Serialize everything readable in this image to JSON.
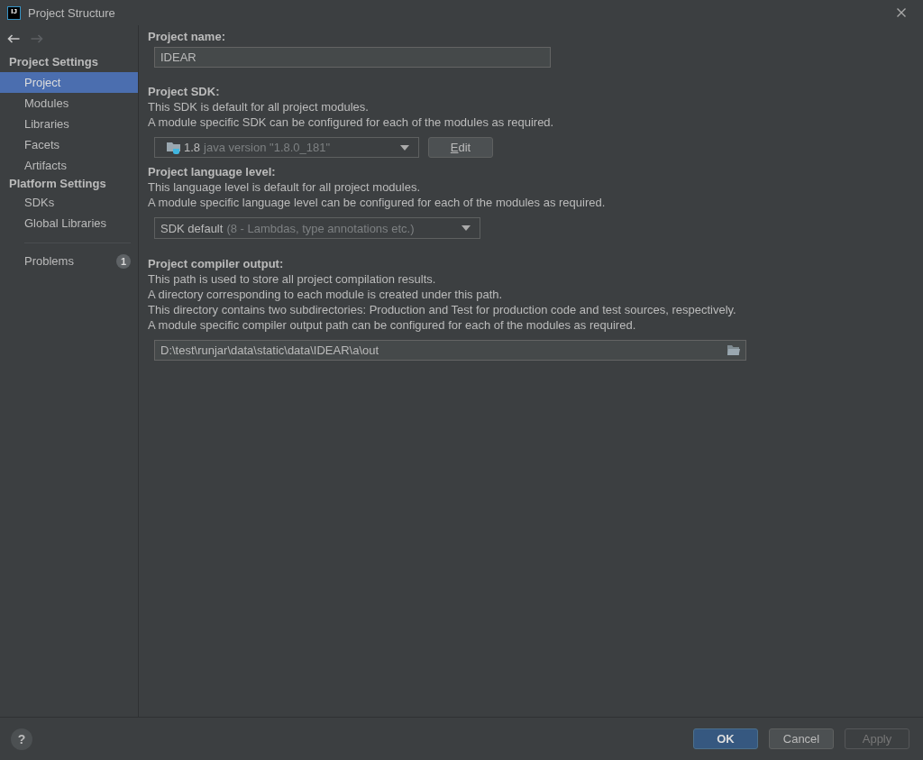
{
  "window": {
    "logo": "IJ",
    "title": "Project Structure"
  },
  "sidebar": {
    "navigation": {
      "back": {
        "disabled": false
      },
      "forward": {
        "disabled": true
      }
    },
    "sections": [
      {
        "heading": "Project Settings",
        "items": [
          {
            "label": "Project",
            "selected": true
          },
          {
            "label": "Modules",
            "selected": false
          },
          {
            "label": "Libraries",
            "selected": false
          },
          {
            "label": "Facets",
            "selected": false
          },
          {
            "label": "Artifacts",
            "selected": false
          }
        ]
      },
      {
        "heading": "Platform Settings",
        "items": [
          {
            "label": "SDKs",
            "selected": false
          },
          {
            "label": "Global Libraries",
            "selected": false
          }
        ]
      }
    ],
    "problems": {
      "label": "Problems",
      "count": "1",
      "selected": false
    }
  },
  "form": {
    "project_name": {
      "label": "Project name:",
      "value": "IDEAR"
    },
    "project_sdk": {
      "label": "Project SDK:",
      "description": [
        "This SDK is default for all project modules.",
        "A module specific SDK can be configured for each of the modules as required."
      ],
      "dropdown": {
        "value": "1.8",
        "detail": "java version \"1.8.0_181\""
      },
      "edit_button": "Edit"
    },
    "language_level": {
      "label": "Project language level:",
      "description": [
        "This language level is default for all project modules.",
        "A module specific language level can be configured for each of the modules as required."
      ],
      "dropdown": {
        "value": "SDK default",
        "detail": "(8 - Lambdas, type annotations etc.)"
      }
    },
    "compiler_output": {
      "label": "Project compiler output:",
      "description": [
        "This path is used to store all project compilation results.",
        "A directory corresponding to each module is created under this path.",
        "This directory contains two subdirectories: Production and Test for production code and test sources, respectively.",
        "A module specific compiler output path can be configured for each of the modules as required."
      ],
      "value": "D:\\test\\runjar\\data\\static\\data\\IDEAR\\a\\out"
    }
  },
  "footer": {
    "help": "?",
    "buttons": [
      {
        "label": "OK",
        "kind": "primary",
        "disabled": false
      },
      {
        "label": "Cancel",
        "kind": "normal",
        "disabled": false
      },
      {
        "label": "Apply",
        "kind": "normal",
        "disabled": true
      }
    ]
  }
}
